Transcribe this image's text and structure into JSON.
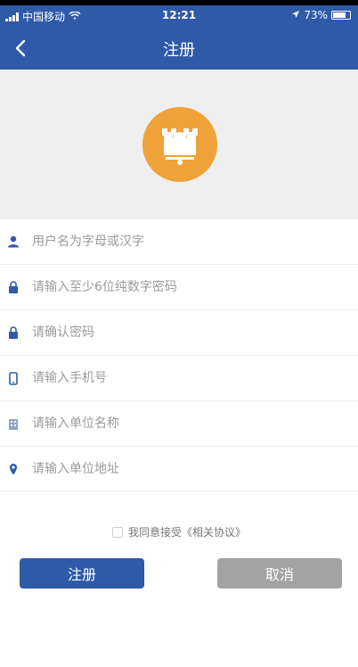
{
  "status_bar": {
    "carrier": "中国移动",
    "time": "12:21",
    "battery": "73%"
  },
  "nav": {
    "title": "注册",
    "back_icon": "chevron-left-icon"
  },
  "colors": {
    "primary": "#2e5aa8",
    "logo": "#f0a23a",
    "cancel": "#a3a3a3"
  },
  "form": {
    "fields": [
      {
        "placeholder": "用户名为字母或汉字",
        "icon": "user-icon"
      },
      {
        "placeholder": "请输入至少6位纯数字密码",
        "icon": "lock-icon"
      },
      {
        "placeholder": "请确认密码",
        "icon": "lock-icon"
      },
      {
        "placeholder": "请输入手机号",
        "icon": "phone-icon"
      },
      {
        "placeholder": "请输入单位名称",
        "icon": "building-icon"
      },
      {
        "placeholder": "请输入单位地址",
        "icon": "location-icon"
      }
    ]
  },
  "agreement": {
    "prefix": "我同意接受",
    "link": "《相关协议》"
  },
  "buttons": {
    "register": "注册",
    "cancel": "取消"
  }
}
